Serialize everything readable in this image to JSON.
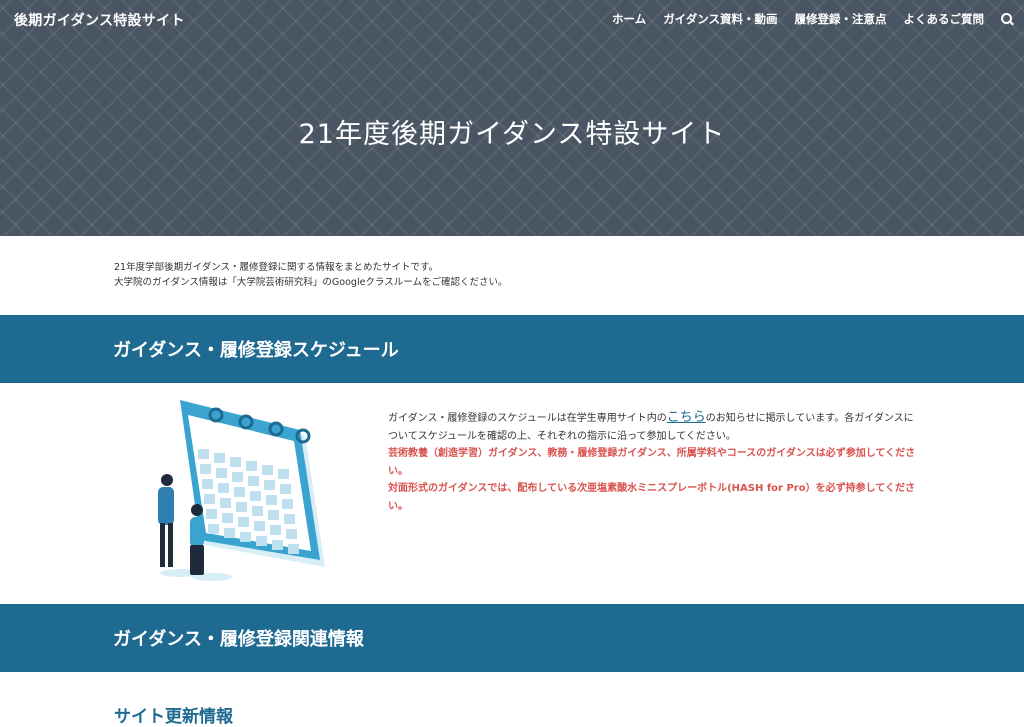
{
  "header": {
    "site_title": "後期ガイダンス特設サイト",
    "nav": [
      "ホーム",
      "ガイダンス資料・動画",
      "履修登録・注意点",
      "よくあるご質問"
    ],
    "search_icon": "search-icon"
  },
  "hero": {
    "title": "21年度後期ガイダンス特設サイト"
  },
  "intro": {
    "line1": "21年度学部後期ガイダンス・履修登録に関する情報をまとめたサイトです。",
    "line2": "大学院のガイダンス情報は「大学院芸術研究科」のGoogleクラスルームをご確認ください。"
  },
  "schedule": {
    "heading": "ガイダンス・履修登録スケジュール",
    "text_before_link": "ガイダンス・履修登録のスケジュールは在学生専用サイト内の",
    "link_text": "こちら",
    "text_after_link": "のお知らせに掲示しています。各ガイダンスについてスケジュールを確認の上、それぞれの指示に沿って参加してください。",
    "red_line1": "芸術教養（創造学習）ガイダンス、教務・履修登録ガイダンス、所属学科やコースのガイダンスは必ず参加してください。",
    "red_line2": "対面形式のガイダンスでは、配布している次亜塩素酸水ミニスプレーボトル(HASH for Pro）を必ず持参してください。",
    "illustration": "calendar-illustration"
  },
  "related": {
    "heading": "ガイダンス・履修登録関連情報"
  },
  "updates": {
    "heading": "サイト更新情報"
  },
  "colors": {
    "band": "#1f6a91",
    "hero": "#4a5563",
    "alert": "#d9534f"
  }
}
